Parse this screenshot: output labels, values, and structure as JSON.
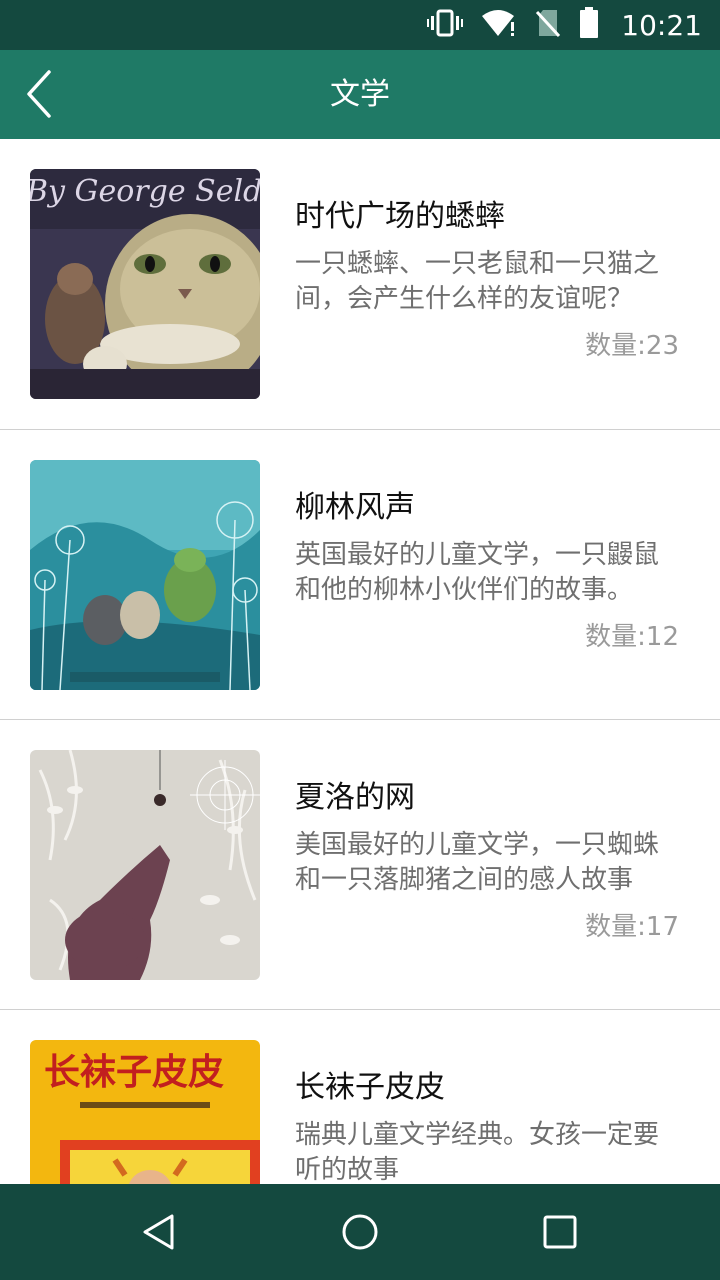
{
  "status_bar": {
    "time": "10:21",
    "icons": [
      "vibrate-icon",
      "wifi-icon",
      "no-sim-icon",
      "battery-icon"
    ]
  },
  "app_bar": {
    "title": "文学",
    "back_icon": "chevron-left-icon"
  },
  "books": [
    {
      "title": "时代广场的蟋蟀",
      "description": "一只蟋蟀、一只老鼠和一只猫之间，会产生什么样的友谊呢？",
      "count": "数量:23",
      "cover_text": "By George Selden"
    },
    {
      "title": "柳林风声",
      "description": "英国最好的儿童文学，一只鼹鼠和他的柳林小伙伴们的故事。",
      "count": "数量:12"
    },
    {
      "title": "夏洛的网",
      "description": "美国最好的儿童文学，一只蜘蛛和一只落脚猪之间的感人故事",
      "count": "数量:17"
    },
    {
      "title": "长袜子皮皮",
      "description": "瑞典儿童文学经典。女孩一定要听的故事",
      "count": "",
      "cover_text": "长袜子皮皮"
    }
  ],
  "nav_bar": {
    "icons": [
      "back-triangle-icon",
      "home-circle-icon",
      "recents-square-icon"
    ]
  },
  "colors": {
    "status_bar": "#14493f",
    "app_bar": "#1f7a66",
    "title_text": "#111111",
    "desc_text": "#6f6f6f",
    "count_text": "#9a9a9a"
  }
}
